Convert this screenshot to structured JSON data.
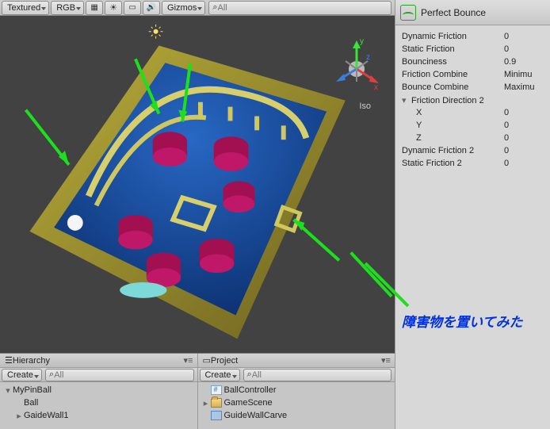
{
  "toolbar": {
    "shading": "Textured",
    "render_mode": "RGB",
    "gizmos": "Gizmos",
    "search_placeholder": "All",
    "search_icon": "⌕"
  },
  "scene": {
    "iso_label": "Iso",
    "axis": {
      "x": "x",
      "y": "y",
      "z": "z"
    }
  },
  "hierarchy": {
    "tab": "Hierarchy",
    "create": "Create",
    "search_placeholder": "All",
    "items": [
      {
        "name": "MyPinBall",
        "depth": 0,
        "expanded": true
      },
      {
        "name": "Ball",
        "depth": 1,
        "expanded": false
      },
      {
        "name": "GaideWall1",
        "depth": 1,
        "expanded": false
      }
    ]
  },
  "project": {
    "tab": "Project",
    "create": "Create",
    "search_placeholder": "All",
    "items": [
      {
        "name": "BallController",
        "depth": 0,
        "expanded": false,
        "icon": "script"
      },
      {
        "name": "GameScene",
        "depth": 0,
        "expanded": true,
        "icon": "folder"
      },
      {
        "name": "GuideWallCarve",
        "depth": 0,
        "expanded": false,
        "icon": "prefab"
      }
    ]
  },
  "inspector": {
    "title": "Perfect Bounce",
    "rows": [
      {
        "label": "Dynamic Friction",
        "value": "0"
      },
      {
        "label": "Static Friction",
        "value": "0"
      },
      {
        "label": "Bounciness",
        "value": "0.9"
      },
      {
        "label": "Friction Combine",
        "value": "Minimu"
      },
      {
        "label": "Bounce Combine",
        "value": "Maximu"
      },
      {
        "label": "Friction Direction 2",
        "value": "",
        "foldout": true
      },
      {
        "label": "X",
        "value": "0",
        "indent": true
      },
      {
        "label": "Y",
        "value": "0",
        "indent": true
      },
      {
        "label": "Z",
        "value": "0",
        "indent": true
      },
      {
        "label": "Dynamic Friction 2",
        "value": "0"
      },
      {
        "label": "Static Friction 2",
        "value": "0"
      }
    ]
  },
  "annotation": "障害物を置いてみた"
}
